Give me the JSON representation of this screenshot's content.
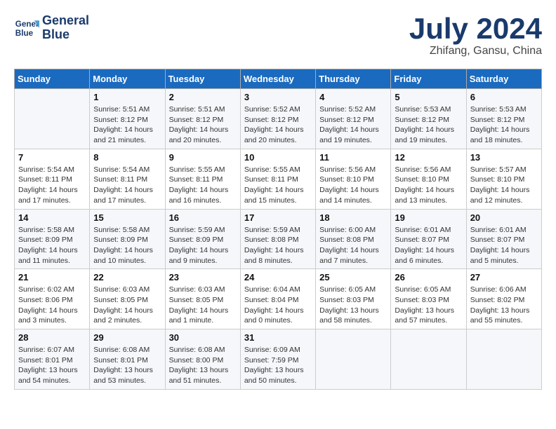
{
  "logo": {
    "line1": "General",
    "line2": "Blue"
  },
  "title": "July 2024",
  "subtitle": "Zhifang, Gansu, China",
  "days_of_week": [
    "Sunday",
    "Monday",
    "Tuesday",
    "Wednesday",
    "Thursday",
    "Friday",
    "Saturday"
  ],
  "weeks": [
    [
      {
        "day": "",
        "info": ""
      },
      {
        "day": "1",
        "info": "Sunrise: 5:51 AM\nSunset: 8:12 PM\nDaylight: 14 hours\nand 21 minutes."
      },
      {
        "day": "2",
        "info": "Sunrise: 5:51 AM\nSunset: 8:12 PM\nDaylight: 14 hours\nand 20 minutes."
      },
      {
        "day": "3",
        "info": "Sunrise: 5:52 AM\nSunset: 8:12 PM\nDaylight: 14 hours\nand 20 minutes."
      },
      {
        "day": "4",
        "info": "Sunrise: 5:52 AM\nSunset: 8:12 PM\nDaylight: 14 hours\nand 19 minutes."
      },
      {
        "day": "5",
        "info": "Sunrise: 5:53 AM\nSunset: 8:12 PM\nDaylight: 14 hours\nand 19 minutes."
      },
      {
        "day": "6",
        "info": "Sunrise: 5:53 AM\nSunset: 8:12 PM\nDaylight: 14 hours\nand 18 minutes."
      }
    ],
    [
      {
        "day": "7",
        "info": "Sunrise: 5:54 AM\nSunset: 8:11 PM\nDaylight: 14 hours\nand 17 minutes."
      },
      {
        "day": "8",
        "info": "Sunrise: 5:54 AM\nSunset: 8:11 PM\nDaylight: 14 hours\nand 17 minutes."
      },
      {
        "day": "9",
        "info": "Sunrise: 5:55 AM\nSunset: 8:11 PM\nDaylight: 14 hours\nand 16 minutes."
      },
      {
        "day": "10",
        "info": "Sunrise: 5:55 AM\nSunset: 8:11 PM\nDaylight: 14 hours\nand 15 minutes."
      },
      {
        "day": "11",
        "info": "Sunrise: 5:56 AM\nSunset: 8:10 PM\nDaylight: 14 hours\nand 14 minutes."
      },
      {
        "day": "12",
        "info": "Sunrise: 5:56 AM\nSunset: 8:10 PM\nDaylight: 14 hours\nand 13 minutes."
      },
      {
        "day": "13",
        "info": "Sunrise: 5:57 AM\nSunset: 8:10 PM\nDaylight: 14 hours\nand 12 minutes."
      }
    ],
    [
      {
        "day": "14",
        "info": "Sunrise: 5:58 AM\nSunset: 8:09 PM\nDaylight: 14 hours\nand 11 minutes."
      },
      {
        "day": "15",
        "info": "Sunrise: 5:58 AM\nSunset: 8:09 PM\nDaylight: 14 hours\nand 10 minutes."
      },
      {
        "day": "16",
        "info": "Sunrise: 5:59 AM\nSunset: 8:09 PM\nDaylight: 14 hours\nand 9 minutes."
      },
      {
        "day": "17",
        "info": "Sunrise: 5:59 AM\nSunset: 8:08 PM\nDaylight: 14 hours\nand 8 minutes."
      },
      {
        "day": "18",
        "info": "Sunrise: 6:00 AM\nSunset: 8:08 PM\nDaylight: 14 hours\nand 7 minutes."
      },
      {
        "day": "19",
        "info": "Sunrise: 6:01 AM\nSunset: 8:07 PM\nDaylight: 14 hours\nand 6 minutes."
      },
      {
        "day": "20",
        "info": "Sunrise: 6:01 AM\nSunset: 8:07 PM\nDaylight: 14 hours\nand 5 minutes."
      }
    ],
    [
      {
        "day": "21",
        "info": "Sunrise: 6:02 AM\nSunset: 8:06 PM\nDaylight: 14 hours\nand 3 minutes."
      },
      {
        "day": "22",
        "info": "Sunrise: 6:03 AM\nSunset: 8:05 PM\nDaylight: 14 hours\nand 2 minutes."
      },
      {
        "day": "23",
        "info": "Sunrise: 6:03 AM\nSunset: 8:05 PM\nDaylight: 14 hours\nand 1 minute."
      },
      {
        "day": "24",
        "info": "Sunrise: 6:04 AM\nSunset: 8:04 PM\nDaylight: 14 hours\nand 0 minutes."
      },
      {
        "day": "25",
        "info": "Sunrise: 6:05 AM\nSunset: 8:03 PM\nDaylight: 13 hours\nand 58 minutes."
      },
      {
        "day": "26",
        "info": "Sunrise: 6:05 AM\nSunset: 8:03 PM\nDaylight: 13 hours\nand 57 minutes."
      },
      {
        "day": "27",
        "info": "Sunrise: 6:06 AM\nSunset: 8:02 PM\nDaylight: 13 hours\nand 55 minutes."
      }
    ],
    [
      {
        "day": "28",
        "info": "Sunrise: 6:07 AM\nSunset: 8:01 PM\nDaylight: 13 hours\nand 54 minutes."
      },
      {
        "day": "29",
        "info": "Sunrise: 6:08 AM\nSunset: 8:01 PM\nDaylight: 13 hours\nand 53 minutes."
      },
      {
        "day": "30",
        "info": "Sunrise: 6:08 AM\nSunset: 8:00 PM\nDaylight: 13 hours\nand 51 minutes."
      },
      {
        "day": "31",
        "info": "Sunrise: 6:09 AM\nSunset: 7:59 PM\nDaylight: 13 hours\nand 50 minutes."
      },
      {
        "day": "",
        "info": ""
      },
      {
        "day": "",
        "info": ""
      },
      {
        "day": "",
        "info": ""
      }
    ]
  ]
}
